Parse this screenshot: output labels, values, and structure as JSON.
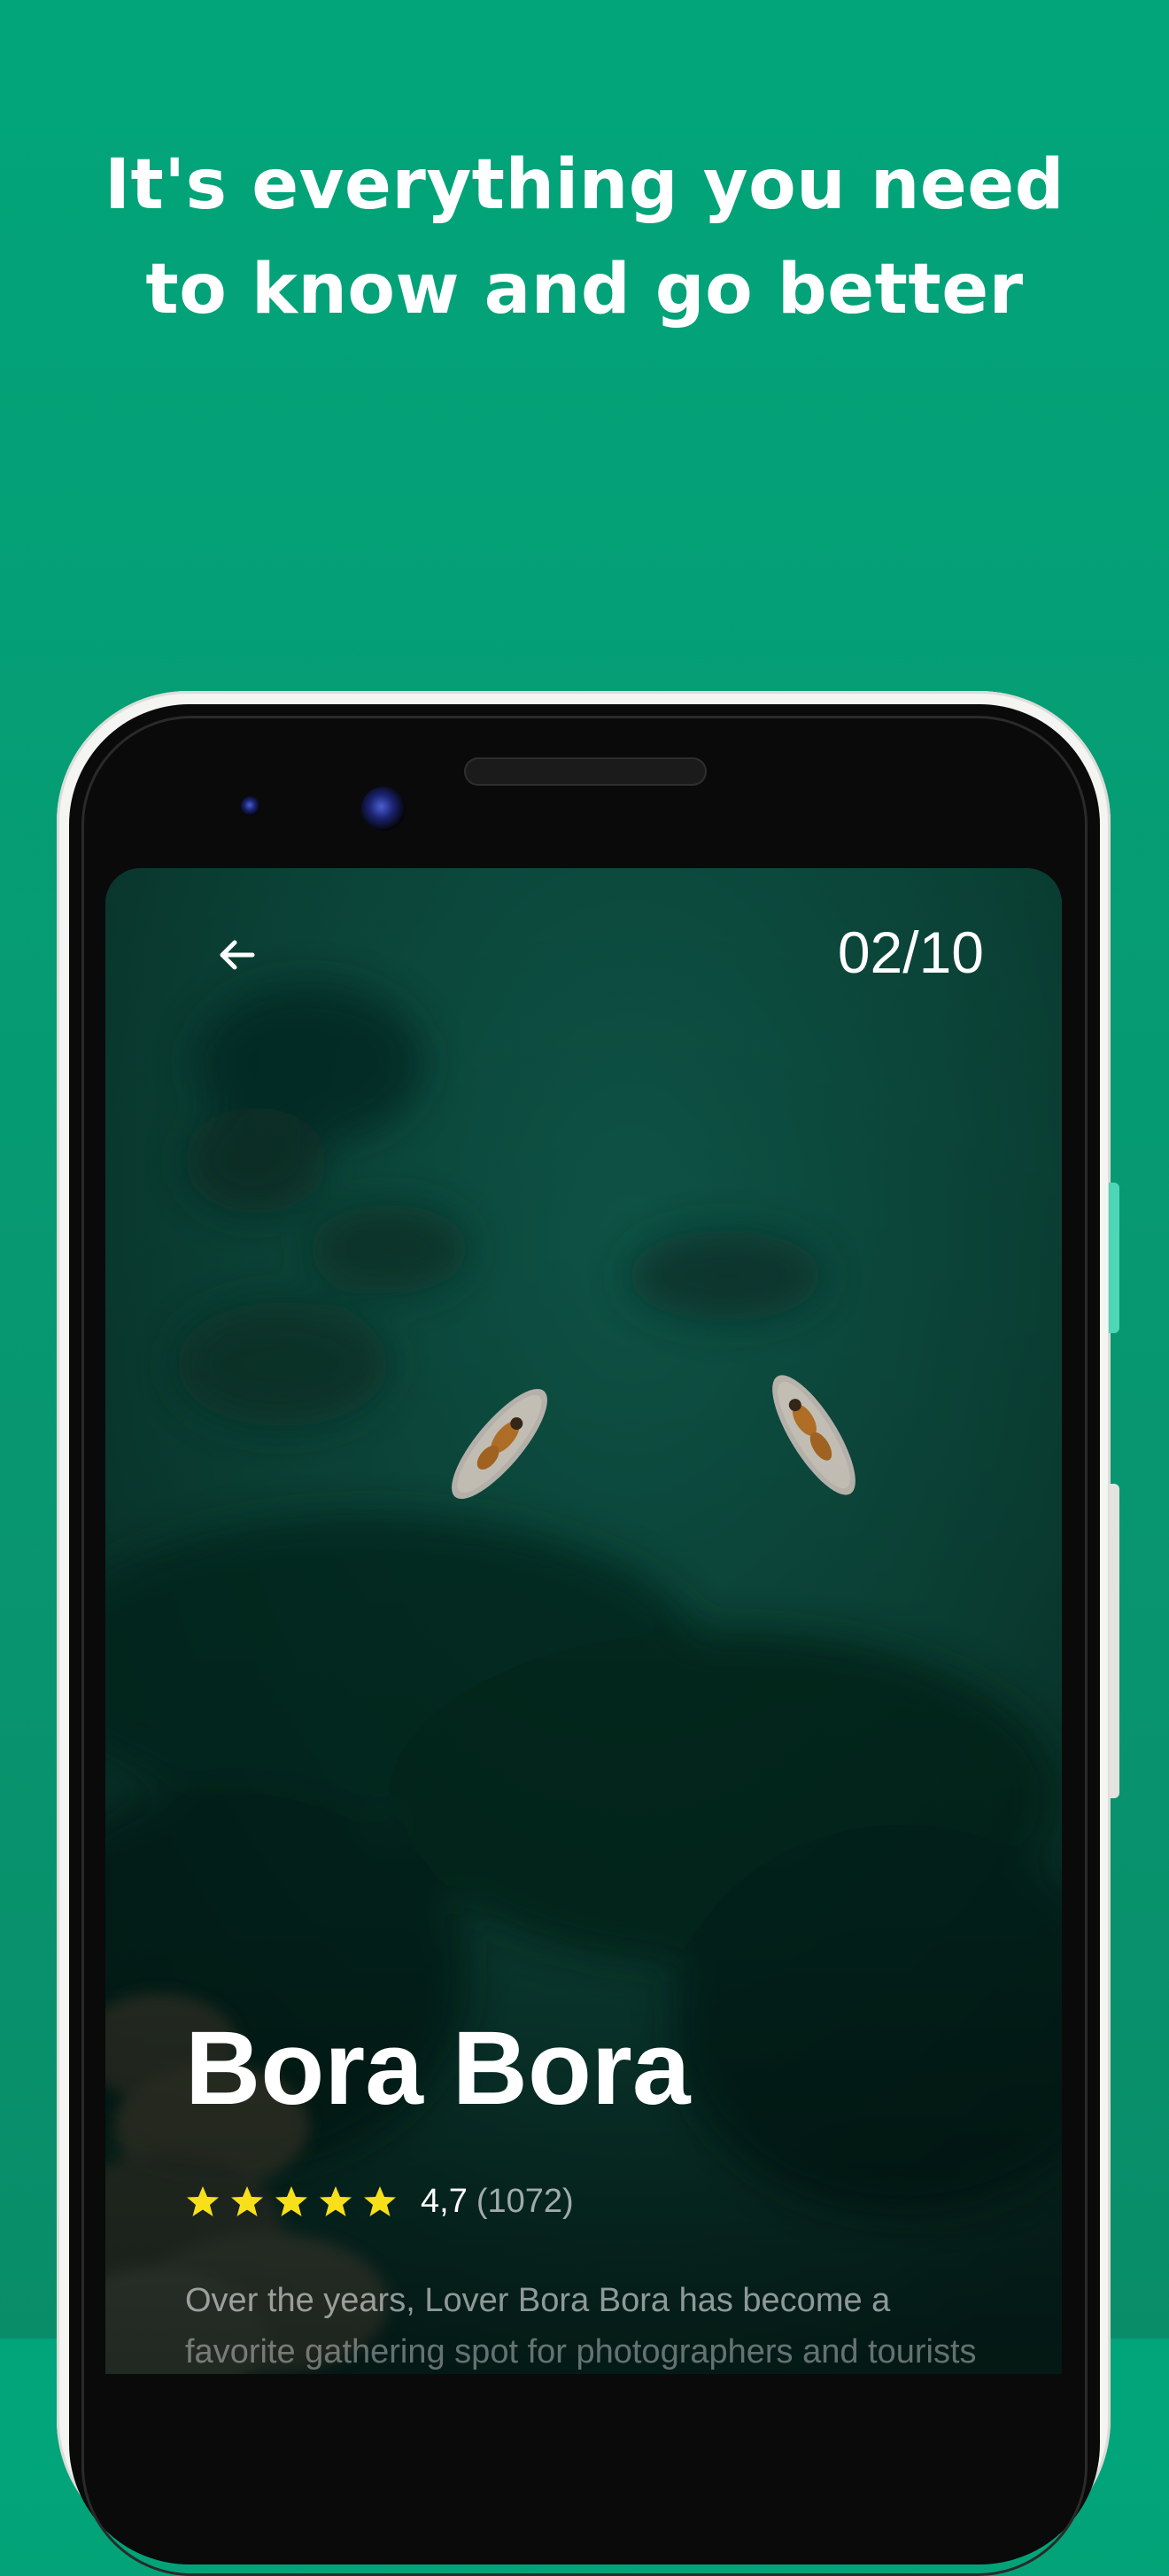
{
  "headline": {
    "line1": "It's everything you need",
    "line2": "to know and go better"
  },
  "screen": {
    "counter": "02/10",
    "back_icon": "arrow-left-icon",
    "place": {
      "name": "Bora Bora",
      "rating": "4,7",
      "review_count": "(1072)",
      "stars": 5,
      "description_line1": "Over the years, Lover Bora Bora has become a",
      "description_line2": "favorite gathering spot for photographers and tourists"
    }
  },
  "colors": {
    "background": "#02a57a",
    "star": "#f7e01a",
    "text": "#ffffff"
  }
}
